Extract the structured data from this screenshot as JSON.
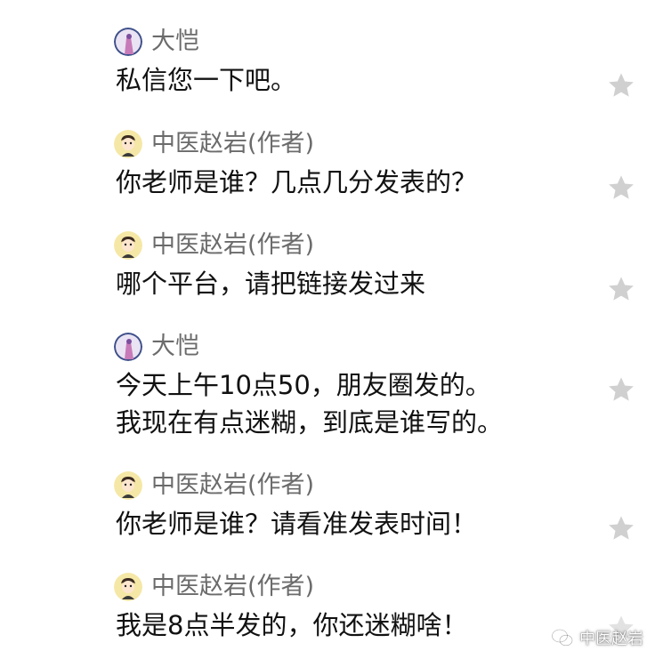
{
  "colors": {
    "author_name": "#6b6b6b",
    "body_text": "#111111",
    "star": "#d0d0d0",
    "background": "#ffffff"
  },
  "comments": [
    {
      "author": "大恺",
      "avatar_icon": "avatar-purple-figure-icon",
      "lines": [
        "私信您一下吧。"
      ],
      "star_icon": "star-icon"
    },
    {
      "author": "中医赵岩(作者)",
      "avatar_icon": "avatar-cartoon-person-icon",
      "lines": [
        "你老师是谁？几点几分发表的？"
      ],
      "star_icon": "star-icon"
    },
    {
      "author": "中医赵岩(作者)",
      "avatar_icon": "avatar-cartoon-person-icon",
      "lines": [
        "哪个平台，请把链接发过来"
      ],
      "star_icon": "star-icon"
    },
    {
      "author": "大恺",
      "avatar_icon": "avatar-purple-figure-icon",
      "lines": [
        "今天上午10点50，朋友圈发的。",
        "我现在有点迷糊，到底是谁写的。"
      ],
      "star_icon": "star-icon"
    },
    {
      "author": "中医赵岩(作者)",
      "avatar_icon": "avatar-cartoon-person-icon",
      "lines": [
        "你老师是谁？请看准发表时间！"
      ],
      "star_icon": "star-icon"
    },
    {
      "author": "中医赵岩(作者)",
      "avatar_icon": "avatar-cartoon-person-icon",
      "lines": [
        "我是8点半发的，你还迷糊啥！"
      ],
      "star_icon": "star-icon"
    }
  ],
  "watermark": {
    "icon": "wechat-official-account-icon",
    "text": "中医赵岩"
  }
}
